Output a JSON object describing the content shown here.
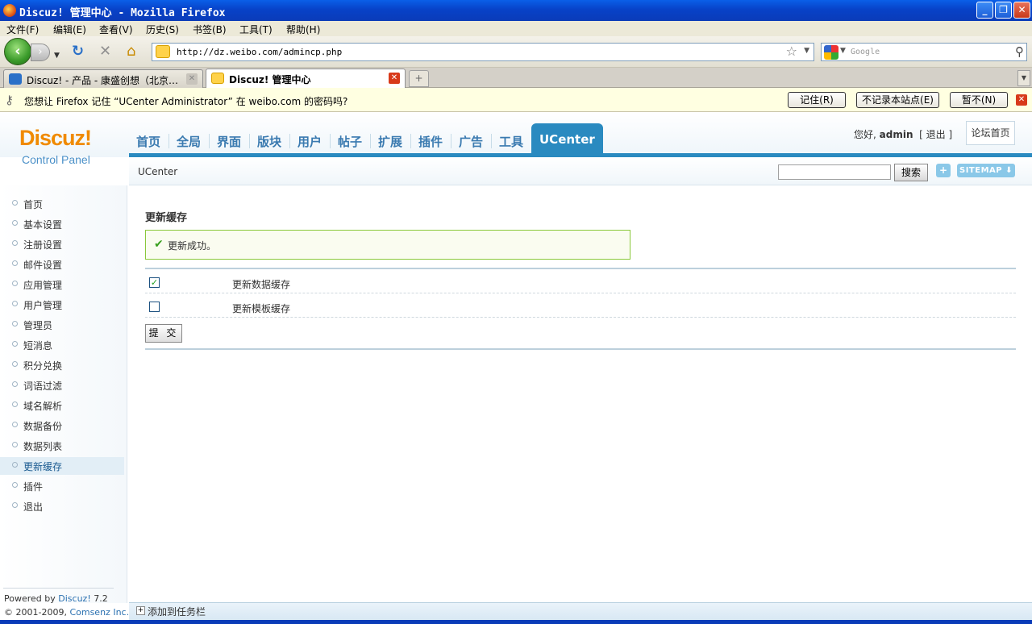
{
  "window": {
    "title": "Discuz! 管理中心 - Mozilla Firefox"
  },
  "menu": {
    "items": [
      "文件(F)",
      "编辑(E)",
      "查看(V)",
      "历史(S)",
      "书签(B)",
      "工具(T)",
      "帮助(H)"
    ]
  },
  "navbar": {
    "url": "http://dz.weibo.com/admincp.php",
    "search_placeholder": "Google"
  },
  "tabs": [
    {
      "label": "Discuz! - 产品 - 康盛创想（北京…"
    },
    {
      "label": "Discuz! 管理中心"
    }
  ],
  "notification": {
    "message": "您想让 Firefox 记住 “UCenter Administrator” 在 weibo.com 的密码吗?",
    "remember": "记住(R)",
    "never": "不记录本站点(E)",
    "not_now": "暂不(N)"
  },
  "logo": {
    "main": "Discuz!",
    "sub": "Control Panel"
  },
  "top_nav": {
    "items": [
      "首页",
      "全局",
      "界面",
      "版块",
      "用户",
      "帖子",
      "扩展",
      "插件",
      "广告",
      "工具",
      "UCenter"
    ],
    "active": "UCenter"
  },
  "user": {
    "greeting": "您好,",
    "name": "admin",
    "logout": "[ 退出 ]",
    "forum_home": "论坛首页"
  },
  "subheader": {
    "breadcrumb": "UCenter",
    "search_button": "搜索",
    "plus": "+",
    "sitemap": "SITEMAP"
  },
  "sidebar": {
    "items": [
      "首页",
      "基本设置",
      "注册设置",
      "邮件设置",
      "应用管理",
      "用户管理",
      "管理员",
      "短消息",
      "积分兑换",
      "词语过滤",
      "域名解析",
      "数据备份",
      "数据列表",
      "更新缓存",
      "插件",
      "退出"
    ],
    "active": "更新缓存",
    "footer_powered": "Powered by",
    "footer_product": "Discuz!",
    "footer_version": "7.2",
    "footer_copy": "© 2001-2009,",
    "footer_company": "Comsenz Inc."
  },
  "main": {
    "heading": "更新缓存",
    "success": "更新成功。",
    "options": [
      {
        "label": "更新数据缓存",
        "checked": true
      },
      {
        "label": "更新模板缓存",
        "checked": false
      }
    ],
    "submit": "提 交"
  },
  "bottombar": {
    "text": "添加到任务栏"
  },
  "colors": {
    "accent": "#2a8ac0",
    "logo_orange": "#f08a00",
    "success_border": "#8ac83a"
  }
}
